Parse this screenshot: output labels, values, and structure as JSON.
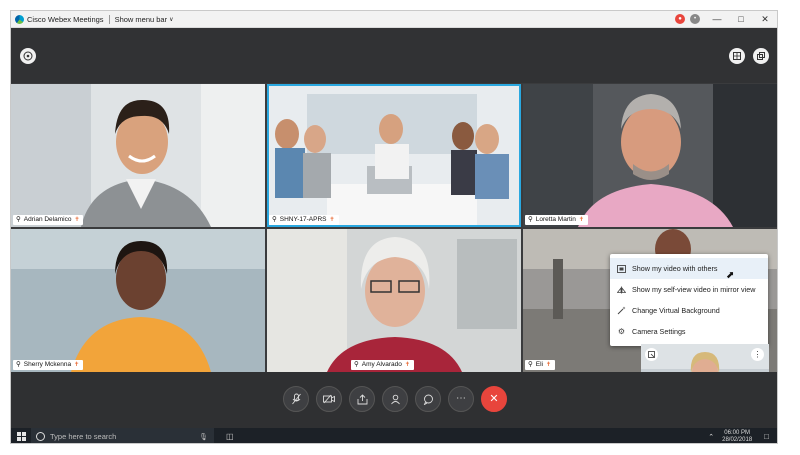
{
  "titlebar": {
    "app_name": "Cisco Webex Meetings",
    "show_menu_bar_label": "Show menu bar"
  },
  "participants": [
    {
      "name": "Adrian Delamico",
      "muted": true
    },
    {
      "name": "SHNY-17-APRS",
      "muted": true
    },
    {
      "name": "Loretta Martin",
      "muted": true
    },
    {
      "name": "Sherry Mckenna",
      "muted": true
    },
    {
      "name": "Amy Alvarado",
      "muted": true
    },
    {
      "name": "Eli",
      "muted": true
    }
  ],
  "active_speaker_index": 1,
  "video_menu": {
    "items": [
      {
        "label": "Show my video with others",
        "icon": "show-video-icon",
        "highlighted": true
      },
      {
        "label": "Show my self-view video in mirror view",
        "icon": "mirror-icon",
        "highlighted": false
      },
      {
        "label": "Change Virtual Background",
        "icon": "magic-wand-icon",
        "highlighted": false
      },
      {
        "label": "Camera Settings",
        "icon": "gear-icon",
        "highlighted": false
      }
    ]
  },
  "controls": [
    "mute",
    "stop-video",
    "share",
    "participants",
    "chat",
    "more",
    "end-meeting"
  ],
  "taskbar": {
    "search_placeholder": "Type here to search",
    "time": "06:00 PM",
    "date": "28/02/2018"
  },
  "colors": {
    "accent_active_speaker": "#2aa8e0",
    "end_button": "#e8453c",
    "muted_icon": "#e8632b"
  }
}
